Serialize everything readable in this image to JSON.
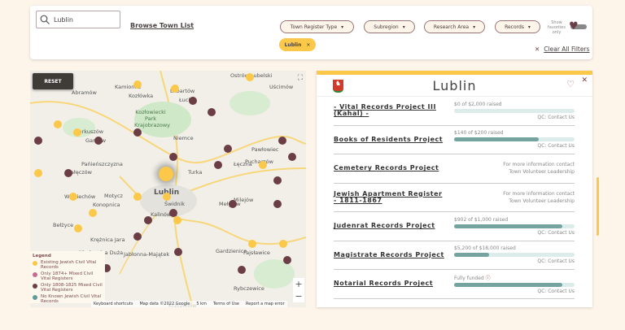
{
  "search": {
    "value": "Lublin",
    "icon": "search-icon"
  },
  "browse_link": "Browse Town List",
  "filters": [
    {
      "label": "Town Register Type"
    },
    {
      "label": "Subregion"
    },
    {
      "label": "Research Area"
    },
    {
      "label": "Records"
    }
  ],
  "favorites_toggle": {
    "label": "Show favorites only",
    "on": false
  },
  "active_chip": "Lublin",
  "clear_all": "Clear All Filters",
  "map": {
    "reset": "RESET",
    "places": [
      "Kamionka",
      "Lubartów",
      "Ostrów Lubelski",
      "Abramów",
      "Kozłówka",
      "Łucka",
      "Uścimów",
      "Kozłowiecki Park Krajobrazowy",
      "Markuszów",
      "Garbów",
      "Niemce",
      "Pawłowiec",
      "Pańieńszczyzna",
      "Nałęczów",
      "Turka",
      "Pucharzów",
      "Łęczna",
      "Lublin",
      "Wojciechów",
      "Motycz",
      "Konopnica",
      "Świdnik",
      "Mełgiew",
      "Milejów",
      "Kalinówka",
      "Bełżyce",
      "Krężnica Jara",
      "Niedrzwica Duża",
      "Jabłonna-Majątek",
      "Gardzienice",
      "Fajsławice",
      "Rybczewice",
      "Krzczonów"
    ],
    "legend": {
      "title": "Legend",
      "items": [
        {
          "label": "Existing Jewish Civil Vital Records",
          "color": "#fcc84a"
        },
        {
          "label": "Only 1874+ Mixed Civil Vital Registers",
          "color": "#c76b93"
        },
        {
          "label": "Only 1808-1825 Mixed Civil Vital Registers",
          "color": "#6b3d45"
        },
        {
          "label": "No Known Jewish Civil Vital Records",
          "color": "#5f9b98"
        }
      ]
    },
    "attribution": [
      "Keyboard shortcuts",
      "Map data ©2022 Google",
      "5 km",
      "Terms of Use",
      "Report a map error"
    ]
  },
  "panel": {
    "title": "Lublin",
    "projects": [
      {
        "name": "- Vital Records Project III (Kahal) -",
        "status": "$0 of $2,000 raised",
        "progress": 0,
        "qc": "QC: Contact Us"
      },
      {
        "name": "Books of Residents Project",
        "status": "$140 of $200 raised",
        "progress": 70,
        "qc": "QC: Contact Us"
      },
      {
        "name": "Cemetery Records Project",
        "info": [
          "For more information contact",
          "Town Volunteer Leadership"
        ]
      },
      {
        "name": "Jewish Apartment Register - 1811-1867",
        "info": [
          "For more information contact",
          "Town Volunteer Leadership"
        ]
      },
      {
        "name": "Judenrat Records Project",
        "status": "$902 of $1,000 raised",
        "progress": 90,
        "qc": "QC: Contact Us"
      },
      {
        "name": "Magistrate Records Project",
        "status": "$5,200 of $18,000 raised",
        "progress": 29,
        "qc": "QC: Contact Us"
      },
      {
        "name": "Notarial Records Project",
        "status": "Fully funded",
        "progress": 90,
        "qc": "QC: Contact Us"
      }
    ]
  },
  "colors": {
    "accent": "#fcc84a",
    "brown": "#6b3d45",
    "teal": "#74a3a0"
  }
}
